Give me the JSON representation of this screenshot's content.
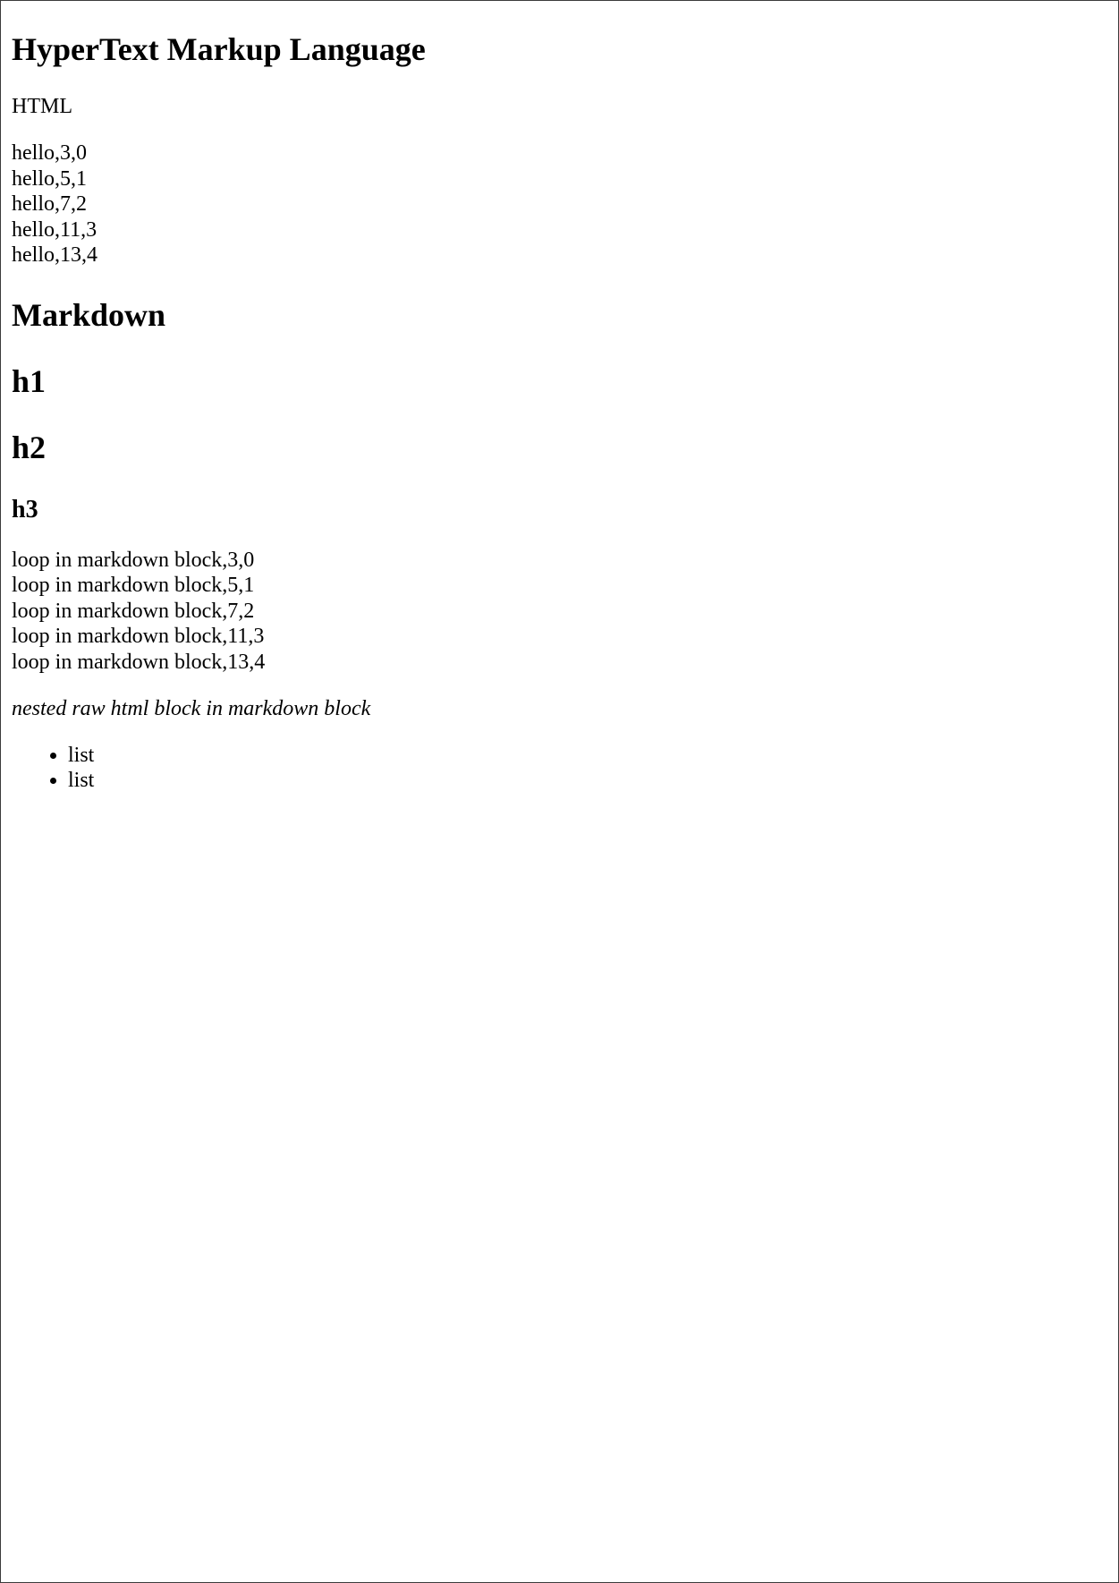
{
  "html_section": {
    "title": "HyperText Markup Language",
    "subtitle": "HTML",
    "loop_lines": [
      "hello,3,0",
      "hello,5,1",
      "hello,7,2",
      "hello,11,3",
      "hello,13,4"
    ]
  },
  "markdown_section": {
    "title": "Markdown",
    "h1": "h1",
    "h2": "h2",
    "h3": "h3",
    "loop_lines": [
      "loop in markdown block,3,0",
      "loop in markdown block,5,1",
      "loop in markdown block,7,2",
      "loop in markdown block,11,3",
      "loop in markdown block,13,4"
    ],
    "nested_note": "nested raw html block in markdown block",
    "list_items": [
      "list",
      "list"
    ]
  }
}
